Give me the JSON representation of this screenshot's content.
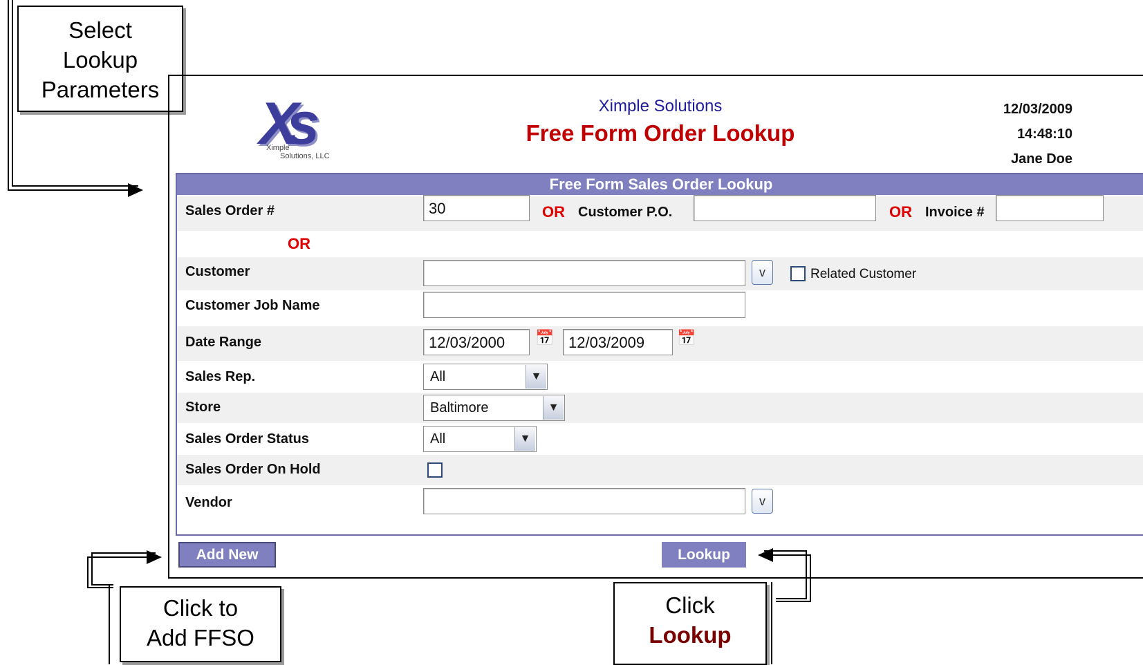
{
  "callouts": {
    "select_params": [
      "Select",
      "Lookup",
      "Parameters"
    ],
    "add_ffso": [
      "Click to",
      "Add FFSO"
    ],
    "click_lookup": [
      "Click",
      "Lookup"
    ]
  },
  "header": {
    "logo_text": "Xs",
    "logo_sub1": "Ximple",
    "logo_sub2": "Solutions, LLC",
    "company": "Ximple Solutions",
    "title": "Free Form Order Lookup",
    "date": "12/03/2009",
    "time": "14:48:10",
    "user": "Jane Doe"
  },
  "form": {
    "title": "Free Form Sales Order Lookup",
    "sales_order_label": "Sales Order #",
    "sales_order_value": "30",
    "or_label": "OR",
    "customer_po_label": "Customer P.O.",
    "customer_po_value": "",
    "invoice_label": "Invoice #",
    "invoice_value": "",
    "customer_label": "Customer",
    "customer_value": "",
    "dropdown_btn": "v",
    "related_customer_label": "Related Customer",
    "customer_job_label": "Customer Job Name",
    "customer_job_value": "",
    "date_range_label": "Date Range",
    "date_from": "12/03/2000",
    "date_to": "12/03/2009",
    "sales_rep_label": "Sales Rep.",
    "sales_rep_value": "All",
    "store_label": "Store",
    "store_value": "Baltimore",
    "status_label": "Sales Order Status",
    "status_value": "All",
    "on_hold_label": "Sales Order On Hold",
    "on_hold_checked": false,
    "vendor_label": "Vendor",
    "vendor_value": ""
  },
  "buttons": {
    "add_new": "Add New",
    "lookup": "Lookup"
  },
  "colors": {
    "header_bar": "#8080c0",
    "title_red": "#c00000",
    "company_blue": "#1d1d9b",
    "or_red": "#e00000",
    "callout_emphasis": "#7a0000"
  }
}
